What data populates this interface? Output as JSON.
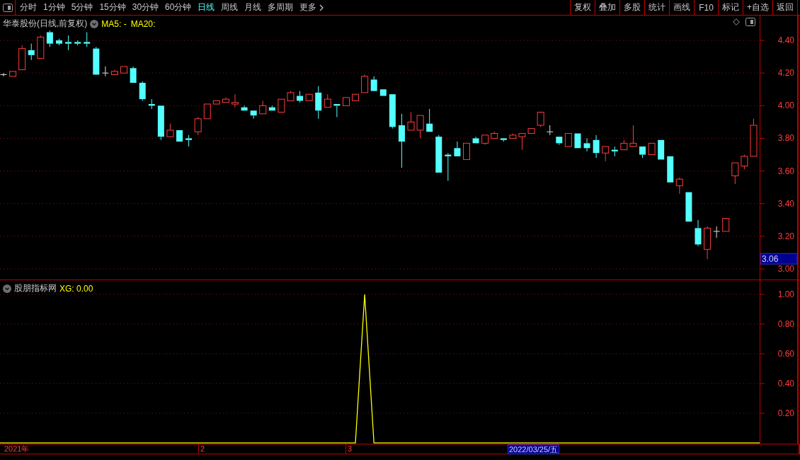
{
  "toolbar": {
    "periods": [
      {
        "label": "分时",
        "selected": false
      },
      {
        "label": "1分钟",
        "selected": false
      },
      {
        "label": "5分钟",
        "selected": false
      },
      {
        "label": "15分钟",
        "selected": false
      },
      {
        "label": "30分钟",
        "selected": false
      },
      {
        "label": "60分钟",
        "selected": false
      },
      {
        "label": "日线",
        "selected": true
      },
      {
        "label": "周线",
        "selected": false
      },
      {
        "label": "月线",
        "selected": false
      },
      {
        "label": "多周期",
        "selected": false
      },
      {
        "label": "更多",
        "selected": false
      }
    ],
    "buttons": [
      "复权",
      "叠加",
      "多股",
      "统计",
      "画线",
      "F10",
      "标记",
      "+自选",
      "返回"
    ]
  },
  "main_chart": {
    "title": "华泰股份(日线,前复权)",
    "ma_labels": [
      "MA5: -",
      "MA20:"
    ],
    "cursor_price": "3.06",
    "chart_data": {
      "type": "candlestick",
      "grid": true,
      "ylim": [
        2.935,
        4.552
      ],
      "yticks": [
        {
          "value": 3.0,
          "label": "3.00"
        },
        {
          "value": 3.2,
          "label": "3.20"
        },
        {
          "value": 3.4,
          "label": "3.40"
        },
        {
          "value": 3.6,
          "label": "3.60"
        },
        {
          "value": 3.8,
          "label": "3.80"
        },
        {
          "value": 4.0,
          "label": "4.00"
        },
        {
          "value": 4.2,
          "label": "4.20"
        },
        {
          "value": 4.4,
          "label": "4.40"
        }
      ],
      "ohlc": [
        [
          4.19,
          4.2,
          4.18,
          4.19
        ],
        [
          4.18,
          4.21,
          4.18,
          4.21
        ],
        [
          4.22,
          4.37,
          4.22,
          4.35
        ],
        [
          4.34,
          4.38,
          4.28,
          4.31
        ],
        [
          4.29,
          4.43,
          4.29,
          4.42
        ],
        [
          4.45,
          4.46,
          4.36,
          4.38
        ],
        [
          4.4,
          4.41,
          4.37,
          4.38
        ],
        [
          4.39,
          4.43,
          4.34,
          4.38
        ],
        [
          4.39,
          4.4,
          4.37,
          4.38
        ],
        [
          4.39,
          4.45,
          4.36,
          4.38
        ],
        [
          4.35,
          4.36,
          4.19,
          4.19
        ],
        [
          4.2,
          4.24,
          4.18,
          4.2
        ],
        [
          4.19,
          4.22,
          4.19,
          4.21
        ],
        [
          4.2,
          4.24,
          4.2,
          4.24
        ],
        [
          4.23,
          4.24,
          4.14,
          4.14
        ],
        [
          4.14,
          4.15,
          4.03,
          4.04
        ],
        [
          4.01,
          4.04,
          3.98,
          4.0
        ],
        [
          4.0,
          4.0,
          3.79,
          3.81
        ],
        [
          3.81,
          3.89,
          3.81,
          3.85
        ],
        [
          3.85,
          3.85,
          3.78,
          3.78
        ],
        [
          3.8,
          3.82,
          3.75,
          3.79
        ],
        [
          3.84,
          3.93,
          3.82,
          3.92
        ],
        [
          3.92,
          4.01,
          3.92,
          4.01
        ],
        [
          4.01,
          4.03,
          4.01,
          4.03
        ],
        [
          4.02,
          4.05,
          4.02,
          4.04
        ],
        [
          4.01,
          4.07,
          3.99,
          4.02
        ],
        [
          3.99,
          4.0,
          3.97,
          3.97
        ],
        [
          3.97,
          3.97,
          3.92,
          3.94
        ],
        [
          3.95,
          4.03,
          3.95,
          4.0
        ],
        [
          3.99,
          4.0,
          3.97,
          3.97
        ],
        [
          3.96,
          4.04,
          3.96,
          4.04
        ],
        [
          4.03,
          4.09,
          4.03,
          4.08
        ],
        [
          4.06,
          4.09,
          4.02,
          4.03
        ],
        [
          4.03,
          4.07,
          4.03,
          4.07
        ],
        [
          4.08,
          4.12,
          3.92,
          3.97
        ],
        [
          3.99,
          4.07,
          3.99,
          4.04
        ],
        [
          4.01,
          4.01,
          3.93,
          4.0
        ],
        [
          4.0,
          4.05,
          4.0,
          4.05
        ],
        [
          4.03,
          4.07,
          4.03,
          4.07
        ],
        [
          4.08,
          4.19,
          4.08,
          4.18
        ],
        [
          4.16,
          4.18,
          4.09,
          4.09
        ],
        [
          4.1,
          4.1,
          4.06,
          4.06
        ],
        [
          4.07,
          4.07,
          3.86,
          3.87
        ],
        [
          3.88,
          3.95,
          3.62,
          3.78
        ],
        [
          3.85,
          3.96,
          3.85,
          3.9
        ],
        [
          3.85,
          3.94,
          3.8,
          3.94
        ],
        [
          3.89,
          3.98,
          3.84,
          3.84
        ],
        [
          3.81,
          3.82,
          3.59,
          3.59
        ],
        [
          3.7,
          3.71,
          3.54,
          3.69
        ],
        [
          3.74,
          3.78,
          3.69,
          3.69
        ],
        [
          3.67,
          3.77,
          3.67,
          3.77
        ],
        [
          3.8,
          3.81,
          3.77,
          3.77
        ],
        [
          3.77,
          3.82,
          3.76,
          3.82
        ],
        [
          3.8,
          3.84,
          3.8,
          3.83
        ],
        [
          3.8,
          3.8,
          3.78,
          3.79
        ],
        [
          3.8,
          3.83,
          3.8,
          3.82
        ],
        [
          3.81,
          3.83,
          3.73,
          3.83
        ],
        [
          3.83,
          3.86,
          3.83,
          3.86
        ],
        [
          3.88,
          3.96,
          3.87,
          3.96
        ],
        [
          3.84,
          3.88,
          3.82,
          3.84
        ],
        [
          3.81,
          3.81,
          3.76,
          3.77
        ],
        [
          3.75,
          3.83,
          3.75,
          3.83
        ],
        [
          3.83,
          3.83,
          3.74,
          3.74
        ],
        [
          3.77,
          3.8,
          3.72,
          3.74
        ],
        [
          3.79,
          3.82,
          3.68,
          3.71
        ],
        [
          3.71,
          3.75,
          3.66,
          3.75
        ],
        [
          3.73,
          3.75,
          3.69,
          3.72
        ],
        [
          3.73,
          3.79,
          3.73,
          3.77
        ],
        [
          3.75,
          3.88,
          3.75,
          3.77
        ],
        [
          3.75,
          3.75,
          3.68,
          3.7
        ],
        [
          3.7,
          3.77,
          3.7,
          3.77
        ],
        [
          3.79,
          3.79,
          3.67,
          3.67
        ],
        [
          3.69,
          3.69,
          3.53,
          3.53
        ],
        [
          3.51,
          3.56,
          3.46,
          3.55
        ],
        [
          3.47,
          3.47,
          3.29,
          3.29
        ],
        [
          3.25,
          3.3,
          3.14,
          3.15
        ],
        [
          3.12,
          3.26,
          3.06,
          3.25
        ],
        [
          3.23,
          3.26,
          3.19,
          3.23
        ],
        [
          3.23,
          3.31,
          3.23,
          3.31
        ],
        [
          3.57,
          3.65,
          3.52,
          3.65
        ],
        [
          3.63,
          3.7,
          3.61,
          3.69
        ],
        [
          3.69,
          3.92,
          3.69,
          3.88
        ]
      ]
    }
  },
  "indicator": {
    "title": "股朋指标网",
    "value_label": "XG: 0.00",
    "chart_data": {
      "type": "line",
      "grid": true,
      "ylim": [
        -0.005,
        1.095
      ],
      "yticks": [
        {
          "value": 0.2,
          "label": "0.20"
        },
        {
          "value": 0.4,
          "label": "0.40"
        },
        {
          "value": 0.6,
          "label": "0.60"
        },
        {
          "value": 0.8,
          "label": "0.80"
        },
        {
          "value": 1.0,
          "label": "1.00"
        }
      ],
      "series": [
        {
          "color": "#ffff00",
          "values": [
            0,
            0,
            0,
            0,
            0,
            0,
            0,
            0,
            0,
            0,
            0,
            0,
            0,
            0,
            0,
            0,
            0,
            0,
            0,
            0,
            0,
            0,
            0,
            0,
            0,
            0,
            0,
            0,
            0,
            0,
            0,
            0,
            0,
            0,
            0,
            0,
            0,
            0,
            0,
            1,
            0,
            0,
            0,
            0,
            0,
            0,
            0,
            0,
            0,
            0,
            0,
            0,
            0,
            0,
            0,
            0,
            0,
            0,
            0,
            0,
            0,
            0,
            0,
            0,
            0,
            0,
            0,
            0,
            0,
            0,
            0,
            0,
            0,
            0,
            0,
            0,
            0,
            0,
            0,
            0,
            0,
            0
          ]
        }
      ]
    }
  },
  "time_axis": {
    "labels": [
      "2021年",
      "2",
      "3"
    ],
    "cursor_date": "2022/03/25/五"
  }
}
